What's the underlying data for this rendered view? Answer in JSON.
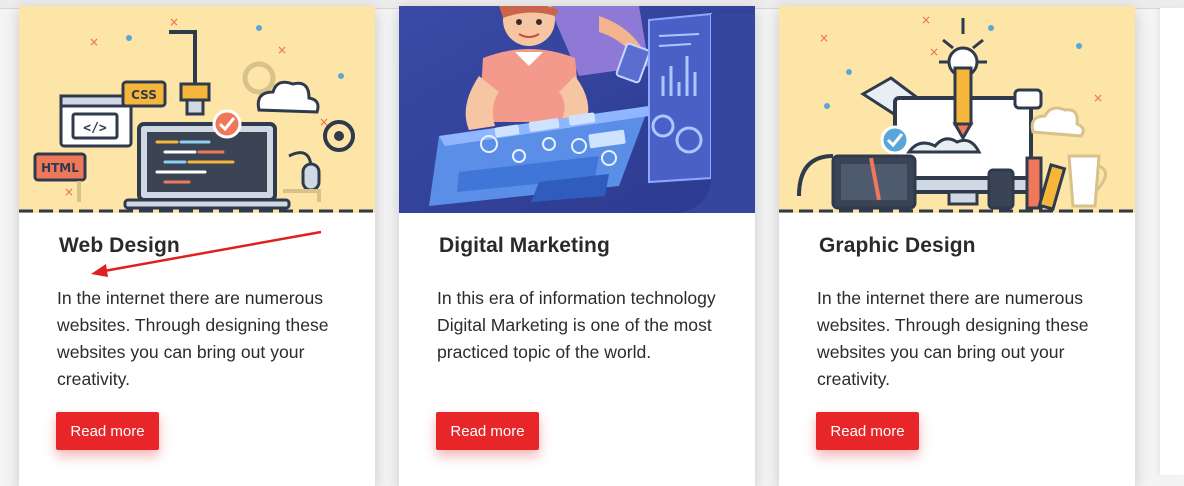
{
  "cards": [
    {
      "title": "Web Design",
      "text": "In the internet there are numerous websites. Through designing these websites you can bring out your creativity.",
      "button_label": "Read more",
      "image": {
        "badges": [
          "CSS",
          "HTML",
          "</>"
        ],
        "background": "#fde5a8"
      }
    },
    {
      "title": "Digital Marketing",
      "text": "In this era of information technology Digital Marketing is one of the most practiced topic of the world.",
      "button_label": "Read more",
      "image": {
        "background": "#3c4ea8"
      }
    },
    {
      "title": "Graphic Design",
      "text": "In the internet there are numerous websites. Through designing these websites you can bring out your creativity.",
      "button_label": "Read more",
      "image": {
        "background": "#fde5a8"
      }
    }
  ],
  "colors": {
    "button": "#e8262a",
    "annotation_arrow": "#e02020"
  }
}
